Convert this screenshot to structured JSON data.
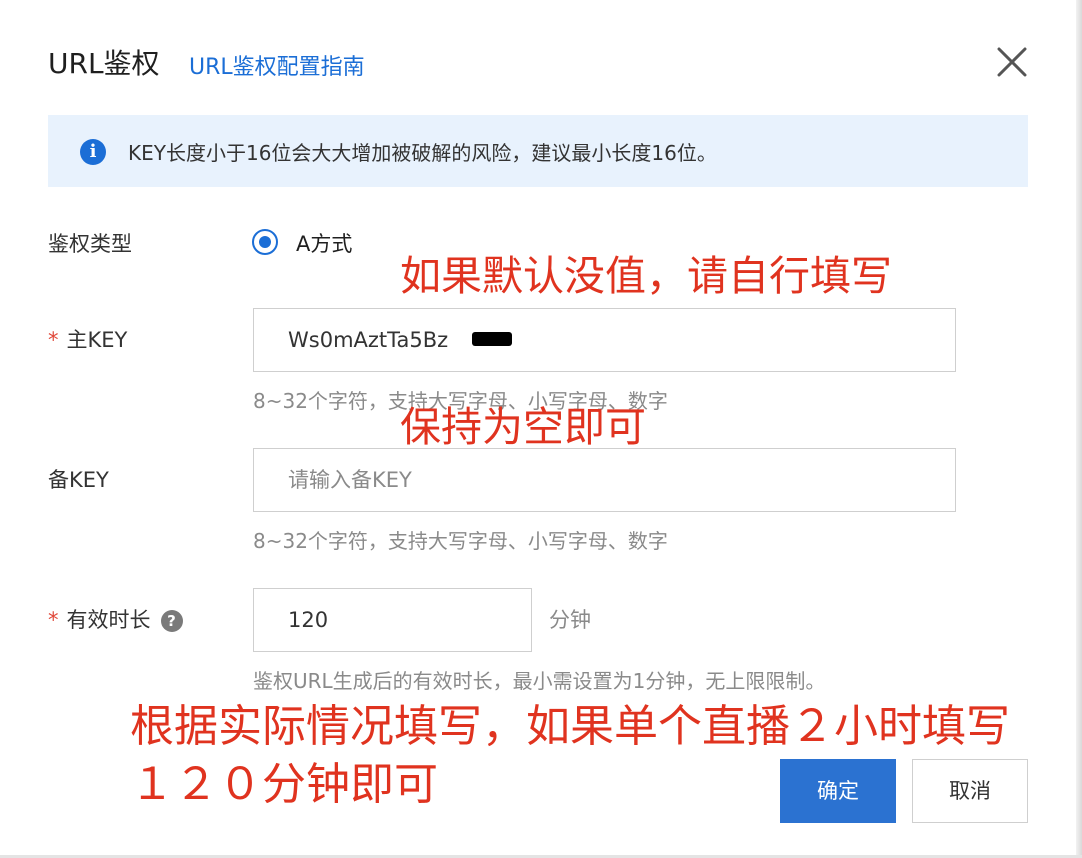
{
  "dialog": {
    "title": "URL鉴权",
    "guide_link": "URL鉴权配置指南"
  },
  "alert": {
    "text": "KEY长度小于16位会大大增加被破解的风险，建议最小长度16位。"
  },
  "form": {
    "auth_type": {
      "label": "鉴权类型",
      "option": "A方式"
    },
    "primary_key": {
      "required_mark": "*",
      "label": "主KEY",
      "value": "Ws0mAztTa5Bz",
      "help": "8~32个字符，支持大写字母、小写字母、数字"
    },
    "backup_key": {
      "label": "备KEY",
      "placeholder": "请输入备KEY",
      "help": "8~32个字符，支持大写字母、小写字母、数字"
    },
    "valid_duration": {
      "required_mark": "*",
      "label": "有效时长",
      "value": "120",
      "unit": "分钟",
      "help": "鉴权URL生成后的有效时长，最小需设置为1分钟，无上限限制。"
    }
  },
  "buttons": {
    "confirm": "确定",
    "cancel": "取消"
  },
  "annotations": {
    "note1": "如果默认没值，请自行填写",
    "note2": "保持为空即可",
    "note3": "根据实际情况填写，如果单个直播２小时填写１２０分钟即可"
  },
  "colors": {
    "primary": "#2b72d1",
    "link": "#1b6ed6",
    "annotation": "#e0331f",
    "alert_bg": "#e8f2fd"
  }
}
